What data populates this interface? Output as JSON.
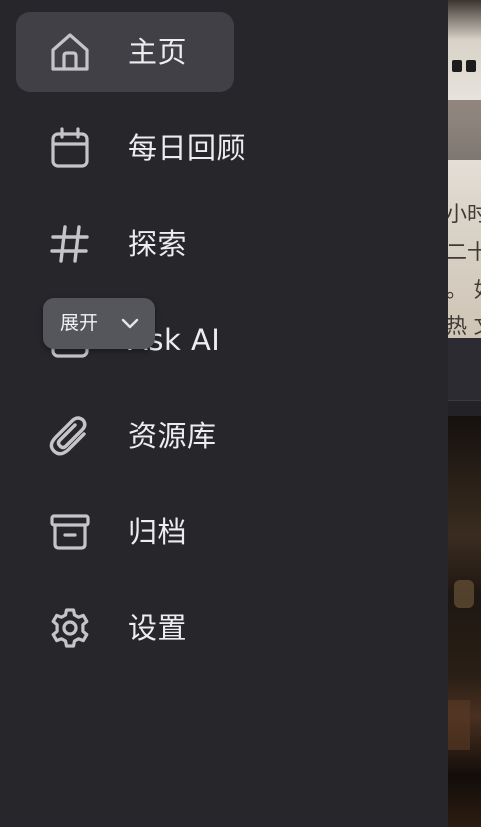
{
  "sidebar": {
    "items": [
      {
        "label": "主页",
        "icon": "home-icon",
        "active": true
      },
      {
        "label": "每日回顾",
        "icon": "calendar-icon",
        "active": false
      },
      {
        "label": "探索",
        "icon": "hashtag-icon",
        "active": false
      },
      {
        "label": "Ask AI",
        "icon": "ai-chat-icon",
        "active": false
      },
      {
        "label": "资源库",
        "icon": "paperclip-icon",
        "active": false
      },
      {
        "label": "归档",
        "icon": "archive-box-icon",
        "active": false
      },
      {
        "label": "设置",
        "icon": "gear-icon",
        "active": false
      }
    ]
  },
  "tooltip": {
    "label": "展开",
    "icon": "chevron-down-icon"
  },
  "background_strip": {
    "text_lines": [
      "小时",
      "二十",
      "。 如",
      "热 文"
    ]
  },
  "colors": {
    "sidebar_bg": "#26262b",
    "active_item_bg": "#404046",
    "label_text": "#ededf0",
    "icon_stroke": "#c4c4c9",
    "tooltip_bg": "#55555c"
  }
}
